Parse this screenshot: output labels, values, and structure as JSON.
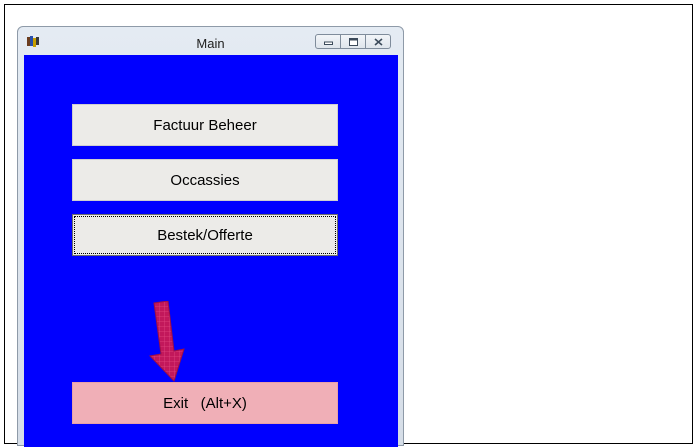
{
  "window": {
    "title": "Main",
    "background_color": "#0000ff",
    "icons": {
      "app": "app-icon",
      "minimize": "minimize-icon",
      "maximize": "maximize-icon",
      "close": "close-icon"
    }
  },
  "buttons": {
    "factuur_beheer": "Factuur Beheer",
    "occassies": "Occassies",
    "bestek_offerte": "Bestek/Offerte",
    "exit": "Exit   (Alt+X)"
  },
  "colors": {
    "button": "#ecebe8",
    "exit_button": "#f0afb7",
    "arrow": "#c2185b"
  },
  "decoration": {
    "arrow_icon": "down-arrow-icon"
  }
}
